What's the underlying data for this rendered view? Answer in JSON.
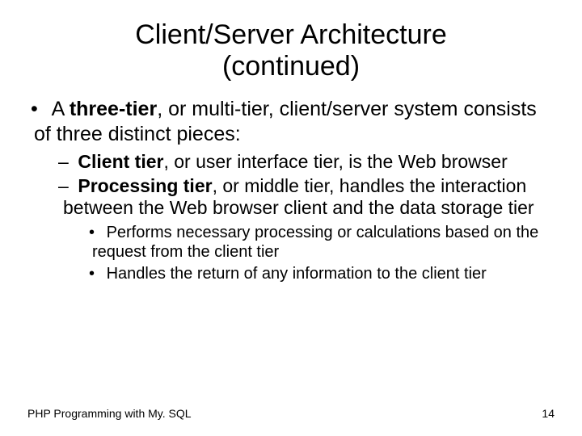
{
  "title_line1": "Client/Server Architecture",
  "title_line2": "(continued)",
  "bullet1_pre": "A ",
  "bullet1_bold": "three-tier",
  "bullet1_post": ", or multi-tier, client/server system consists of three distinct pieces:",
  "sub1a_bold": "Client tier",
  "sub1a_post": ", or user interface tier, is the Web browser",
  "sub1b_bold": "Processing tier",
  "sub1b_post": ", or middle tier, handles the interaction between the Web browser client and the data storage tier",
  "sub2a": "Performs necessary processing or calculations based on the request from the client tier",
  "sub2b": "Handles the return of any information to the client tier",
  "footer_left": "PHP Programming with My. SQL",
  "footer_right": "14"
}
